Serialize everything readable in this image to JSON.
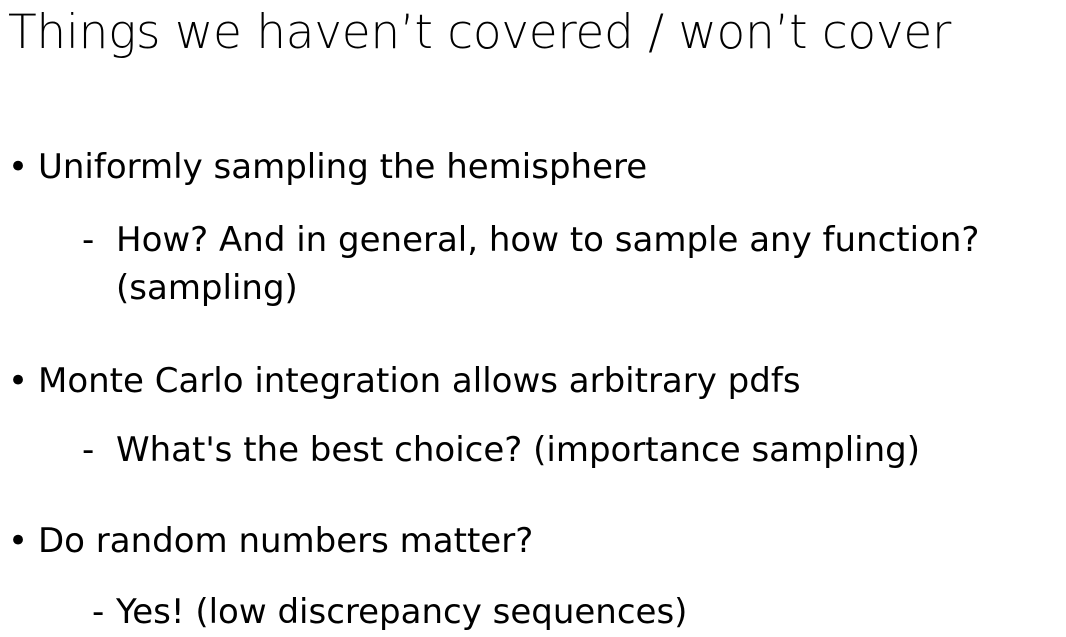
{
  "slide": {
    "title": "Things we haven’t covered / won’t cover",
    "bullets": [
      {
        "marker": "•",
        "text": "Uniformly sampling the hemisphere",
        "sub": {
          "marker": "-",
          "line1": "How? And in general, how to sample any function?",
          "line2": "(sampling)"
        }
      },
      {
        "marker": "•",
        "text": "Monte Carlo integration allows arbitrary pdfs",
        "sub": {
          "marker": "-",
          "line1": "What's the best choice? (importance sampling)"
        }
      },
      {
        "marker": "•",
        "text": "Do random numbers matter?",
        "sub": {
          "marker": "-",
          "line1": "Yes! (low discrepancy sequences)"
        }
      }
    ]
  }
}
